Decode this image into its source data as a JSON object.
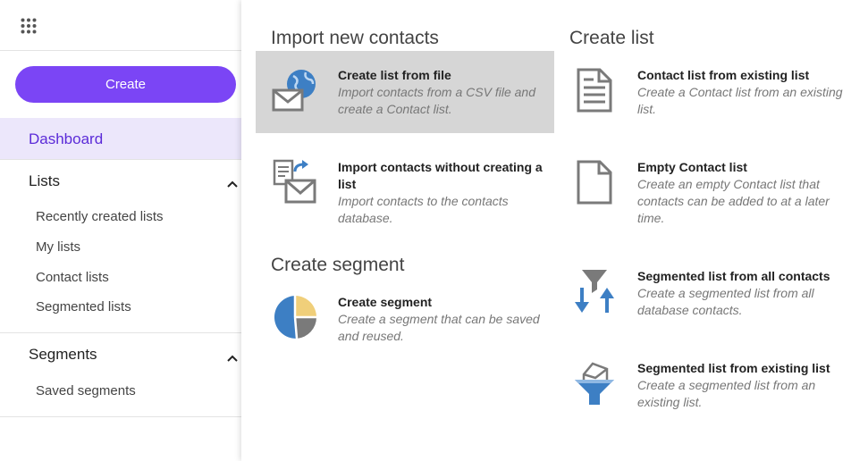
{
  "sidebar": {
    "create_label": "Create",
    "dashboard_label": "Dashboard",
    "lists": {
      "title": "Lists",
      "items": [
        "Recently created lists",
        "My lists",
        "Contact lists",
        "Segmented lists"
      ]
    },
    "segments": {
      "title": "Segments",
      "items": [
        "Saved segments"
      ]
    }
  },
  "panel": {
    "import_section": {
      "title": "Import new contacts",
      "items": [
        {
          "title": "Create list from file",
          "desc": "Import contacts from a CSV file and create a Contact list.",
          "icon": "globe-envelope-icon"
        },
        {
          "title": "Import contacts without creating a list",
          "desc": "Import contacts to the contacts database.",
          "icon": "import-envelope-icon"
        }
      ]
    },
    "segment_section": {
      "title": "Create segment",
      "items": [
        {
          "title": "Create segment",
          "desc": "Create a segment that can be saved and reused.",
          "icon": "pie-chart-icon"
        }
      ]
    },
    "list_section": {
      "title": "Create list",
      "items": [
        {
          "title": "Contact list from existing list",
          "desc": "Create a Contact list from an existing list.",
          "icon": "document-lines-icon"
        },
        {
          "title": "Empty Contact list",
          "desc": "Create an empty Contact list that contacts can be added to at a later time.",
          "icon": "blank-document-icon"
        },
        {
          "title": "Segmented list from all contacts",
          "desc": "Create a segmented list from all database contacts.",
          "icon": "funnel-arrows-icon"
        },
        {
          "title": "Segmented list from existing list",
          "desc": "Create a segmented list from an existing list.",
          "icon": "funnel-envelope-icon"
        }
      ]
    }
  },
  "colors": {
    "accent": "#7b45f5",
    "dashboard_bg": "#ece7fb",
    "dashboard_text": "#5b2bd8",
    "highlight": "#d6d6d6",
    "icon_blue": "#3d7fc4",
    "icon_gray": "#7a7a7a",
    "icon_yellow": "#f0cf7a"
  }
}
